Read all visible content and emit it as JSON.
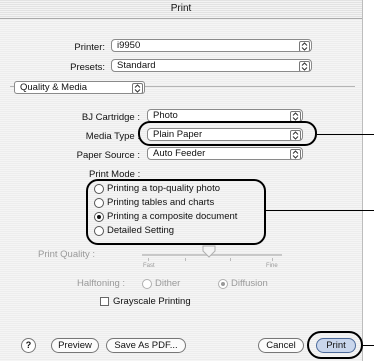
{
  "dialog": {
    "title": "Print"
  },
  "printer": {
    "label": "Printer:",
    "value": "i9950"
  },
  "presets": {
    "label": "Presets:",
    "value": "Standard"
  },
  "panel_menu": {
    "value": "Quality & Media"
  },
  "cartridge": {
    "label": "BJ Cartridge :",
    "value": "Photo"
  },
  "media_type": {
    "label": "Media Type :",
    "value": "Plain Paper"
  },
  "paper_source": {
    "label": "Paper Source :",
    "value": "Auto Feeder"
  },
  "print_mode": {
    "label": "Print Mode :",
    "options": [
      {
        "label": "Printing a top-quality photo",
        "selected": false
      },
      {
        "label": "Printing tables and charts",
        "selected": false
      },
      {
        "label": "Printing a composite document",
        "selected": true
      },
      {
        "label": "Detailed Setting",
        "selected": false
      }
    ]
  },
  "print_quality": {
    "label": "Print Quality :",
    "min_label": "Fast",
    "max_label": "Fine"
  },
  "halftoning": {
    "label": "Halftoning :",
    "options": [
      {
        "label": "Dither",
        "selected": false
      },
      {
        "label": "Diffusion",
        "selected": true
      }
    ]
  },
  "grayscale": {
    "label": "Grayscale Printing",
    "checked": false
  },
  "buttons": {
    "help": "?",
    "preview": "Preview",
    "save_pdf": "Save As PDF...",
    "cancel": "Cancel",
    "print": "Print"
  },
  "colors": {
    "highlight_oval": "#000000",
    "default_button": "#c9d6ec"
  }
}
